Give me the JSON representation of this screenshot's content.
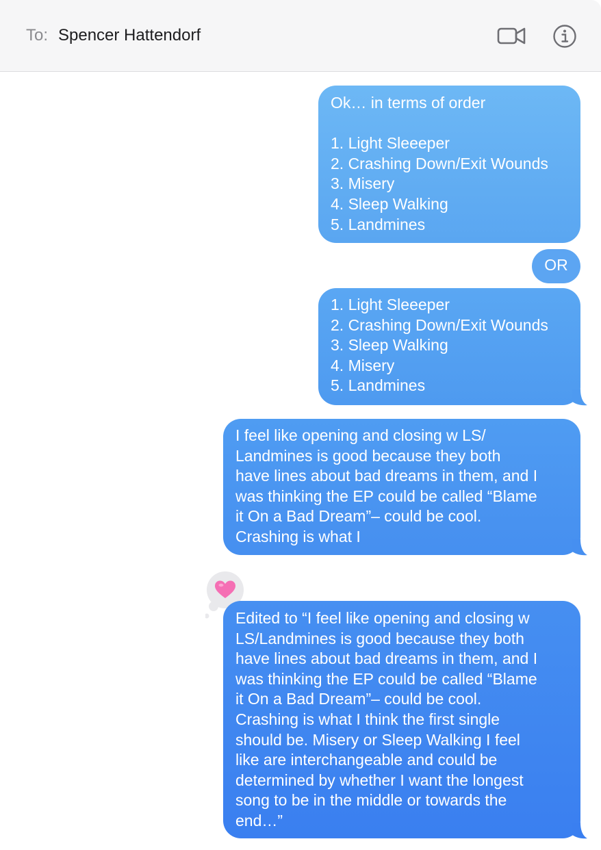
{
  "header": {
    "to_label": "To:",
    "recipient": "Spencer Hattendorf",
    "video_icon": "video-camera-icon",
    "info_icon": "info-icon"
  },
  "colors": {
    "bubble_top": "#6db8f5",
    "bubble_bottom": "#3a7ff0",
    "header_bg": "#f6f6f7",
    "text_on_bubble": "#ffffff"
  },
  "messages": [
    {
      "text": "Ok… in terms of order\n\n1. Light Sleeeper\n2. Crashing Down/Exit Wounds\n3. Misery\n4. Sleep Walking\n5. Landmines"
    },
    {
      "text": "OR"
    },
    {
      "text": "1. Light Sleeeper\n2. Crashing Down/Exit Wounds\n3. Sleep Walking\n4. Misery\n5. Landmines"
    },
    {
      "text": "I feel like opening and closing w LS/\nLandmines is good because they both\nhave lines about bad dreams in them, and I\nwas thinking the EP could be called “Blame\nit On a Bad Dream”– could be cool.\nCrashing is what I"
    },
    {
      "text": "Edited to “I feel like opening and closing w\nLS/Landmines is good because they both\nhave lines about bad dreams in them, and I\nwas thinking the EP could be called “Blame\nit On a Bad Dream”– could be cool.\nCrashing is what I think the first single\nshould be. Misery or Sleep Walking I feel\nlike are interchangeable and could be\ndetermined by whether I want the longest\nsong to be in the middle or towards the\nend…”"
    }
  ],
  "reaction": {
    "icon": "heart-icon"
  }
}
